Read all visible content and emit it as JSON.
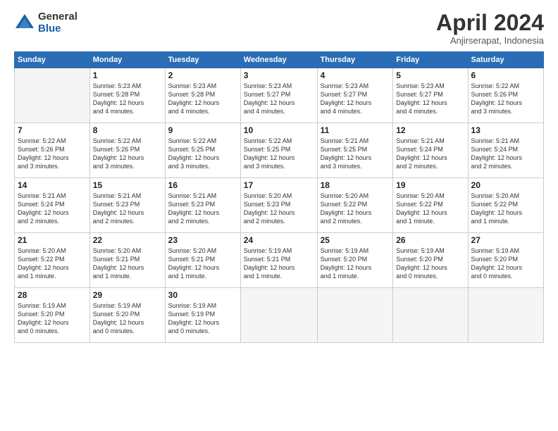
{
  "logo": {
    "general": "General",
    "blue": "Blue"
  },
  "header": {
    "month": "April 2024",
    "location": "Anjirserapat, Indonesia"
  },
  "days_of_week": [
    "Sunday",
    "Monday",
    "Tuesday",
    "Wednesday",
    "Thursday",
    "Friday",
    "Saturday"
  ],
  "weeks": [
    [
      {
        "num": "",
        "info": ""
      },
      {
        "num": "1",
        "info": "Sunrise: 5:23 AM\nSunset: 5:28 PM\nDaylight: 12 hours\nand 4 minutes."
      },
      {
        "num": "2",
        "info": "Sunrise: 5:23 AM\nSunset: 5:28 PM\nDaylight: 12 hours\nand 4 minutes."
      },
      {
        "num": "3",
        "info": "Sunrise: 5:23 AM\nSunset: 5:27 PM\nDaylight: 12 hours\nand 4 minutes."
      },
      {
        "num": "4",
        "info": "Sunrise: 5:23 AM\nSunset: 5:27 PM\nDaylight: 12 hours\nand 4 minutes."
      },
      {
        "num": "5",
        "info": "Sunrise: 5:23 AM\nSunset: 5:27 PM\nDaylight: 12 hours\nand 4 minutes."
      },
      {
        "num": "6",
        "info": "Sunrise: 5:22 AM\nSunset: 5:26 PM\nDaylight: 12 hours\nand 3 minutes."
      }
    ],
    [
      {
        "num": "7",
        "info": "Sunrise: 5:22 AM\nSunset: 5:26 PM\nDaylight: 12 hours\nand 3 minutes."
      },
      {
        "num": "8",
        "info": "Sunrise: 5:22 AM\nSunset: 5:26 PM\nDaylight: 12 hours\nand 3 minutes."
      },
      {
        "num": "9",
        "info": "Sunrise: 5:22 AM\nSunset: 5:25 PM\nDaylight: 12 hours\nand 3 minutes."
      },
      {
        "num": "10",
        "info": "Sunrise: 5:22 AM\nSunset: 5:25 PM\nDaylight: 12 hours\nand 3 minutes."
      },
      {
        "num": "11",
        "info": "Sunrise: 5:21 AM\nSunset: 5:25 PM\nDaylight: 12 hours\nand 3 minutes."
      },
      {
        "num": "12",
        "info": "Sunrise: 5:21 AM\nSunset: 5:24 PM\nDaylight: 12 hours\nand 2 minutes."
      },
      {
        "num": "13",
        "info": "Sunrise: 5:21 AM\nSunset: 5:24 PM\nDaylight: 12 hours\nand 2 minutes."
      }
    ],
    [
      {
        "num": "14",
        "info": "Sunrise: 5:21 AM\nSunset: 5:24 PM\nDaylight: 12 hours\nand 2 minutes."
      },
      {
        "num": "15",
        "info": "Sunrise: 5:21 AM\nSunset: 5:23 PM\nDaylight: 12 hours\nand 2 minutes."
      },
      {
        "num": "16",
        "info": "Sunrise: 5:21 AM\nSunset: 5:23 PM\nDaylight: 12 hours\nand 2 minutes."
      },
      {
        "num": "17",
        "info": "Sunrise: 5:20 AM\nSunset: 5:23 PM\nDaylight: 12 hours\nand 2 minutes."
      },
      {
        "num": "18",
        "info": "Sunrise: 5:20 AM\nSunset: 5:22 PM\nDaylight: 12 hours\nand 2 minutes."
      },
      {
        "num": "19",
        "info": "Sunrise: 5:20 AM\nSunset: 5:22 PM\nDaylight: 12 hours\nand 1 minute."
      },
      {
        "num": "20",
        "info": "Sunrise: 5:20 AM\nSunset: 5:22 PM\nDaylight: 12 hours\nand 1 minute."
      }
    ],
    [
      {
        "num": "21",
        "info": "Sunrise: 5:20 AM\nSunset: 5:22 PM\nDaylight: 12 hours\nand 1 minute."
      },
      {
        "num": "22",
        "info": "Sunrise: 5:20 AM\nSunset: 5:21 PM\nDaylight: 12 hours\nand 1 minute."
      },
      {
        "num": "23",
        "info": "Sunrise: 5:20 AM\nSunset: 5:21 PM\nDaylight: 12 hours\nand 1 minute."
      },
      {
        "num": "24",
        "info": "Sunrise: 5:19 AM\nSunset: 5:21 PM\nDaylight: 12 hours\nand 1 minute."
      },
      {
        "num": "25",
        "info": "Sunrise: 5:19 AM\nSunset: 5:20 PM\nDaylight: 12 hours\nand 1 minute."
      },
      {
        "num": "26",
        "info": "Sunrise: 5:19 AM\nSunset: 5:20 PM\nDaylight: 12 hours\nand 0 minutes."
      },
      {
        "num": "27",
        "info": "Sunrise: 5:19 AM\nSunset: 5:20 PM\nDaylight: 12 hours\nand 0 minutes."
      }
    ],
    [
      {
        "num": "28",
        "info": "Sunrise: 5:19 AM\nSunset: 5:20 PM\nDaylight: 12 hours\nand 0 minutes."
      },
      {
        "num": "29",
        "info": "Sunrise: 5:19 AM\nSunset: 5:20 PM\nDaylight: 12 hours\nand 0 minutes."
      },
      {
        "num": "30",
        "info": "Sunrise: 5:19 AM\nSunset: 5:19 PM\nDaylight: 12 hours\nand 0 minutes."
      },
      {
        "num": "",
        "info": ""
      },
      {
        "num": "",
        "info": ""
      },
      {
        "num": "",
        "info": ""
      },
      {
        "num": "",
        "info": ""
      }
    ]
  ]
}
